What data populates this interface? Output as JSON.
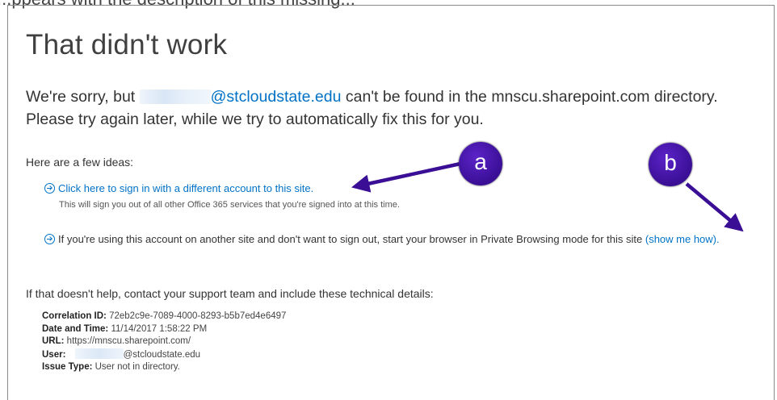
{
  "caption": "...ppears with the description of this missing...",
  "error": {
    "title": "That didn't work",
    "sorry_prefix": "We're sorry, but",
    "email_domain": "@stcloudstate.edu",
    "sorry_suffix": "can't be found in the mnscu.sharepoint.com directory.",
    "sorry_line2": "Please try again later, while we try to automatically fix this for you."
  },
  "ideas": {
    "heading": "Here are a few ideas:",
    "idea1_link": "Click here to sign in with a different account to this site.",
    "idea1_sub": "This will sign you out of all other Office 365 services that you're signed into at this time.",
    "idea2_text": "If you're using this account on another site and don't want to sign out, start your browser in Private Browsing mode for this site",
    "idea2_link": "(show me how)."
  },
  "help": {
    "text": "If that doesn't help, contact your support team and include these technical details:"
  },
  "details": {
    "correlation_label": "Correlation ID:",
    "correlation_value": "72eb2c9e-7089-4000-8293-b5b7ed4e6497",
    "datetime_label": "Date and Time:",
    "datetime_value": "11/14/2017 1:58:22 PM",
    "url_label": "URL:",
    "url_value": "https://mnscu.sharepoint.com/",
    "user_label": "User:",
    "user_value": "@stcloudstate.edu",
    "issue_label": "Issue Type:",
    "issue_value": "User not in directory."
  },
  "annotations": {
    "badge_a": "a",
    "badge_b": "b",
    "badge_color": "#3a0f95",
    "link_color": "#0072c6"
  }
}
